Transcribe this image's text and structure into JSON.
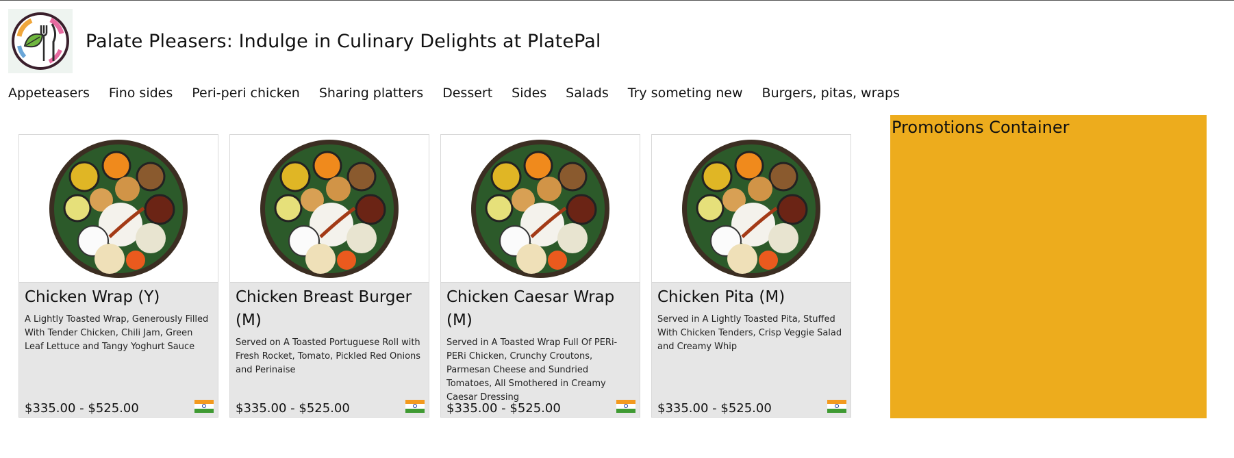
{
  "header": {
    "title": "Palate Pleasers: Indulge in Culinary Delights at PlatePal",
    "logo_icon": "fork-knife-leaf-logo"
  },
  "nav": {
    "items": [
      {
        "label": "Appeteasers"
      },
      {
        "label": "Fino sides"
      },
      {
        "label": "Peri-peri chicken"
      },
      {
        "label": "Sharing platters"
      },
      {
        "label": "Dessert"
      },
      {
        "label": "Sides"
      },
      {
        "label": "Salads"
      },
      {
        "label": "Try someting new"
      },
      {
        "label": "Burgers, pitas, wraps"
      }
    ]
  },
  "menu_items": [
    {
      "name": "Chicken Wrap (Y)",
      "description": "A Lightly Toasted Wrap, Generously Filled With Tender Chicken, Chili Jam, Green Leaf Lettuce and Tangy Yoghurt Sauce",
      "price": "$335.00 - $525.00",
      "image_icon": "thali-plate-image",
      "flag_icon": "india-flag-icon"
    },
    {
      "name": "Chicken Breast Burger (M)",
      "description": "Served on A Toasted Portuguese Roll with Fresh Rocket, Tomato, Pickled Red Onions and Perinaise",
      "price": "$335.00 - $525.00",
      "image_icon": "thali-plate-image",
      "flag_icon": "india-flag-icon"
    },
    {
      "name": "Chicken Caesar Wrap (M)",
      "description": "Served in A Toasted Wrap Full Of PERi-PERi Chicken, Crunchy Croutons, Parmesan Cheese and Sundried Tomatoes, All Smothered in Creamy Caesar Dressing",
      "price": "$335.00 - $525.00",
      "image_icon": "thali-plate-image",
      "flag_icon": "india-flag-icon"
    },
    {
      "name": "Chicken Pita (M)",
      "description": "Served in A Lightly Toasted Pita, Stuffed With Chicken Tenders, Crisp Veggie Salad and Creamy Whip",
      "price": "$335.00 - $525.00",
      "image_icon": "thali-plate-image",
      "flag_icon": "india-flag-icon"
    }
  ],
  "promotions": {
    "title": "Promotions Container",
    "background": "#edac1d"
  },
  "colors": {
    "card_background": "#e6e6e6",
    "promo_background": "#edac1d"
  }
}
